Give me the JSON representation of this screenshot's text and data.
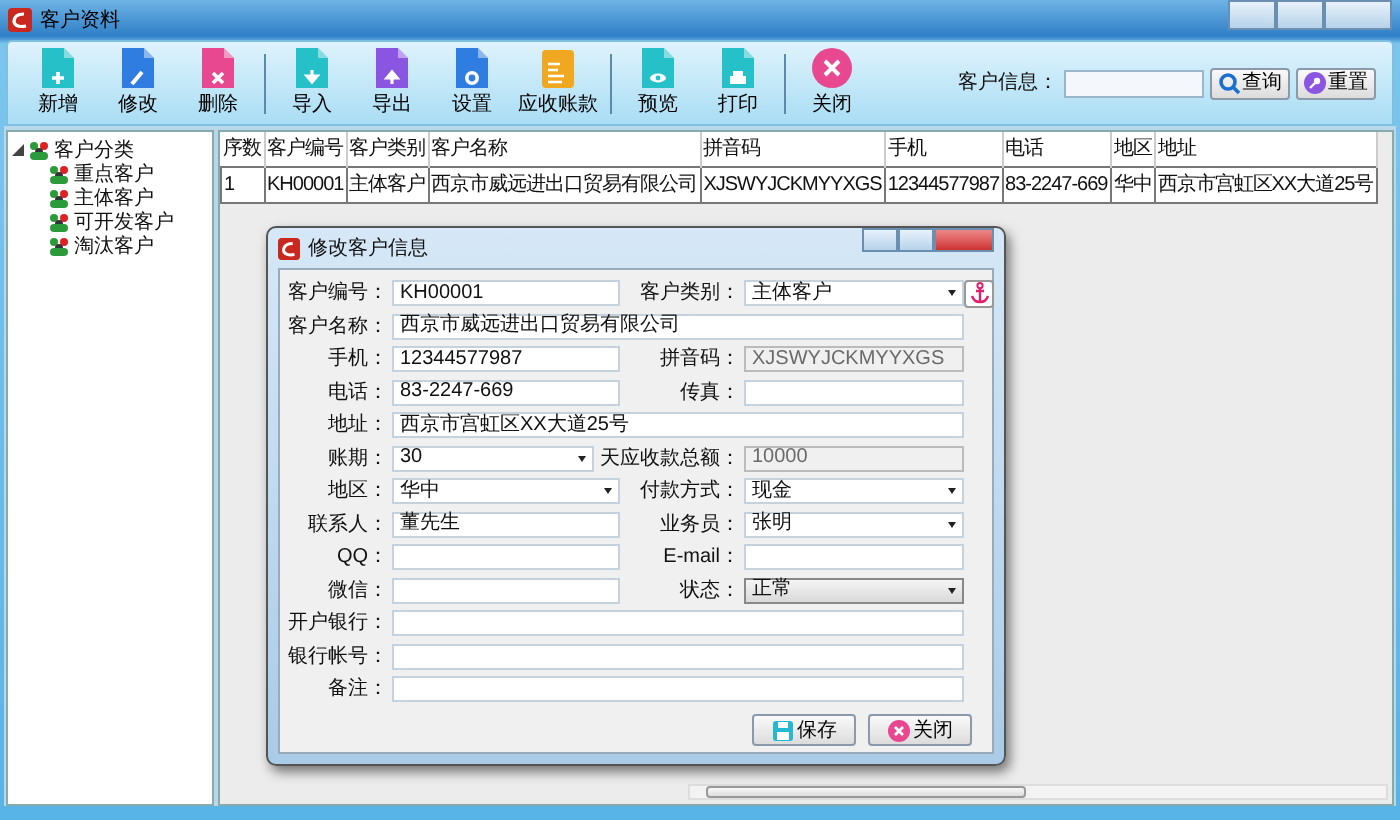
{
  "window": {
    "title": "客户资料"
  },
  "toolbar": {
    "groups": [
      [
        {
          "label": "新增"
        },
        {
          "label": "修改"
        },
        {
          "label": "删除"
        }
      ],
      [
        {
          "label": "导入"
        },
        {
          "label": "导出"
        },
        {
          "label": "设置"
        },
        {
          "label": "应收账款"
        }
      ],
      [
        {
          "label": "预览"
        },
        {
          "label": "打印"
        }
      ],
      [
        {
          "label": "关闭"
        }
      ]
    ]
  },
  "search": {
    "label": "客户信息：",
    "buttons": [
      "查询",
      "重置"
    ]
  },
  "tree": {
    "label": "客户分类",
    "expanded": true,
    "children": [
      {
        "label": "重点客户"
      },
      {
        "label": "主体客户"
      },
      {
        "label": "可开发客户"
      },
      {
        "label": "淘汰客户"
      }
    ]
  },
  "table": {
    "columns": [
      "序数",
      "客户编号",
      "客户类别",
      "客户名称",
      "拼音码",
      "手机",
      "电话",
      "地区",
      "地址"
    ],
    "rows": [
      [
        "1",
        "KH00001",
        "主体客户",
        "西京市威远进出口贸易有限公司",
        "XJSWYJCKMYYXGS",
        "12344577987",
        "83-2247-669",
        "华中",
        "西京市宫虹区XX大道25号"
      ]
    ]
  },
  "dialog": {
    "title": "修改客户信息",
    "rows": [
      [
        {
          "label": "客户编号：",
          "value": "KH00001",
          "kind": "text"
        },
        {
          "label": "客户类别：",
          "value": "主体客户",
          "kind": "select"
        }
      ],
      [
        {
          "label": "客户名称：",
          "value": "西京市威远进出口贸易有限公司",
          "kind": "text",
          "full": true
        }
      ],
      [
        {
          "label": "手机：",
          "value": "12344577987",
          "kind": "text"
        },
        {
          "label": "拼音码：",
          "value": "XJSWYJCKMYYXGS",
          "kind": "text",
          "disabled": true
        }
      ],
      [
        {
          "label": "电话：",
          "value": "83-2247-669",
          "kind": "text"
        },
        {
          "label": "传真：",
          "kind": "text"
        }
      ],
      [
        {
          "label": "地址：",
          "value": "西京市宫虹区XX大道25号",
          "kind": "text",
          "full": true
        }
      ],
      [
        {
          "label": "账期：",
          "value": "30",
          "kind": "select",
          "suffix": "天"
        },
        {
          "label": "应收款总额：",
          "value": "10000",
          "kind": "text",
          "disabled": true
        }
      ],
      [
        {
          "label": "地区：",
          "value": "华中",
          "kind": "select"
        },
        {
          "label": "付款方式：",
          "value": "现金",
          "kind": "select"
        }
      ],
      [
        {
          "label": "联系人：",
          "value": "董先生",
          "kind": "text"
        },
        {
          "label": "业务员：",
          "value": "张明",
          "kind": "select"
        }
      ],
      [
        {
          "label": "QQ：",
          "kind": "text"
        },
        {
          "label": "E-mail：",
          "kind": "text"
        }
      ],
      [
        {
          "label": "微信：",
          "kind": "text"
        },
        {
          "label": "状态：",
          "value": "正常",
          "kind": "dropdown"
        }
      ],
      [
        {
          "label": "开户银行：",
          "kind": "text",
          "full": true
        }
      ],
      [
        {
          "label": "银行帐号：",
          "kind": "text",
          "full": true
        }
      ],
      [
        {
          "label": "备注：",
          "kind": "text",
          "full": true
        }
      ]
    ],
    "buttons": [
      "保存",
      "关闭"
    ]
  }
}
